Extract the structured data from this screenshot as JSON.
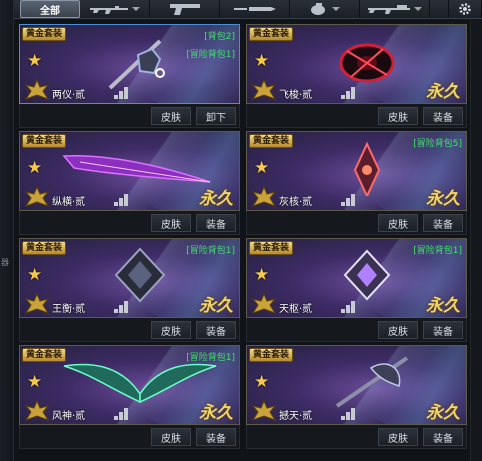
{
  "topbar": {
    "all_tab": "全部",
    "tabs": [
      {
        "icon": "rifle-icon"
      },
      {
        "icon": "pistol-icon"
      },
      {
        "icon": "knife-icon"
      },
      {
        "icon": "grenade-icon"
      },
      {
        "icon": "sniper-icon"
      },
      {
        "icon": "gear-icon"
      }
    ]
  },
  "side_glyph": "器",
  "cards": [
    {
      "badge": "黄金套装",
      "bag1": "[背包2]",
      "bag2": "[冒险背包1]",
      "name": "两仪·贰",
      "perm": "",
      "skin": "皮肤",
      "action": "卸下",
      "weapon": "mace"
    },
    {
      "badge": "黄金套装",
      "bag1": "",
      "bag2": "",
      "name": "飞梭·贰",
      "perm": "永久",
      "skin": "皮肤",
      "action": "装备",
      "weapon": "disc"
    },
    {
      "badge": "黄金套装",
      "bag1": "",
      "bag2": "",
      "name": "纵横·贰",
      "perm": "永久",
      "skin": "皮肤",
      "action": "装备",
      "weapon": "blade"
    },
    {
      "badge": "黄金套装",
      "bag1": "[冒险背包5]",
      "bag2": "",
      "name": "灰核·贰",
      "perm": "永久",
      "skin": "皮肤",
      "action": "装备",
      "weapon": "core"
    },
    {
      "badge": "黄金套装",
      "bag1": "[冒险背包1]",
      "bag2": "",
      "name": "王衡·贰",
      "perm": "永久",
      "skin": "皮肤",
      "action": "装备",
      "weapon": "cube"
    },
    {
      "badge": "黄金套装",
      "bag1": "[冒险背包1]",
      "bag2": "",
      "name": "天枢·贰",
      "perm": "永久",
      "skin": "皮肤",
      "action": "装备",
      "weapon": "gem"
    },
    {
      "badge": "黄金套装",
      "bag1": "[冒险背包1]",
      "bag2": "",
      "name": "风神·贰",
      "perm": "永久",
      "skin": "皮肤",
      "action": "装备",
      "weapon": "wings"
    },
    {
      "badge": "黄金套装",
      "bag1": "",
      "bag2": "",
      "name": "撼天·贰",
      "perm": "永久",
      "skin": "皮肤",
      "action": "装备",
      "weapon": "axe"
    }
  ],
  "colors": {
    "accent_green": "#3fe36a",
    "gold": "#f2d46a",
    "selected_border": "#4a8fd8"
  }
}
